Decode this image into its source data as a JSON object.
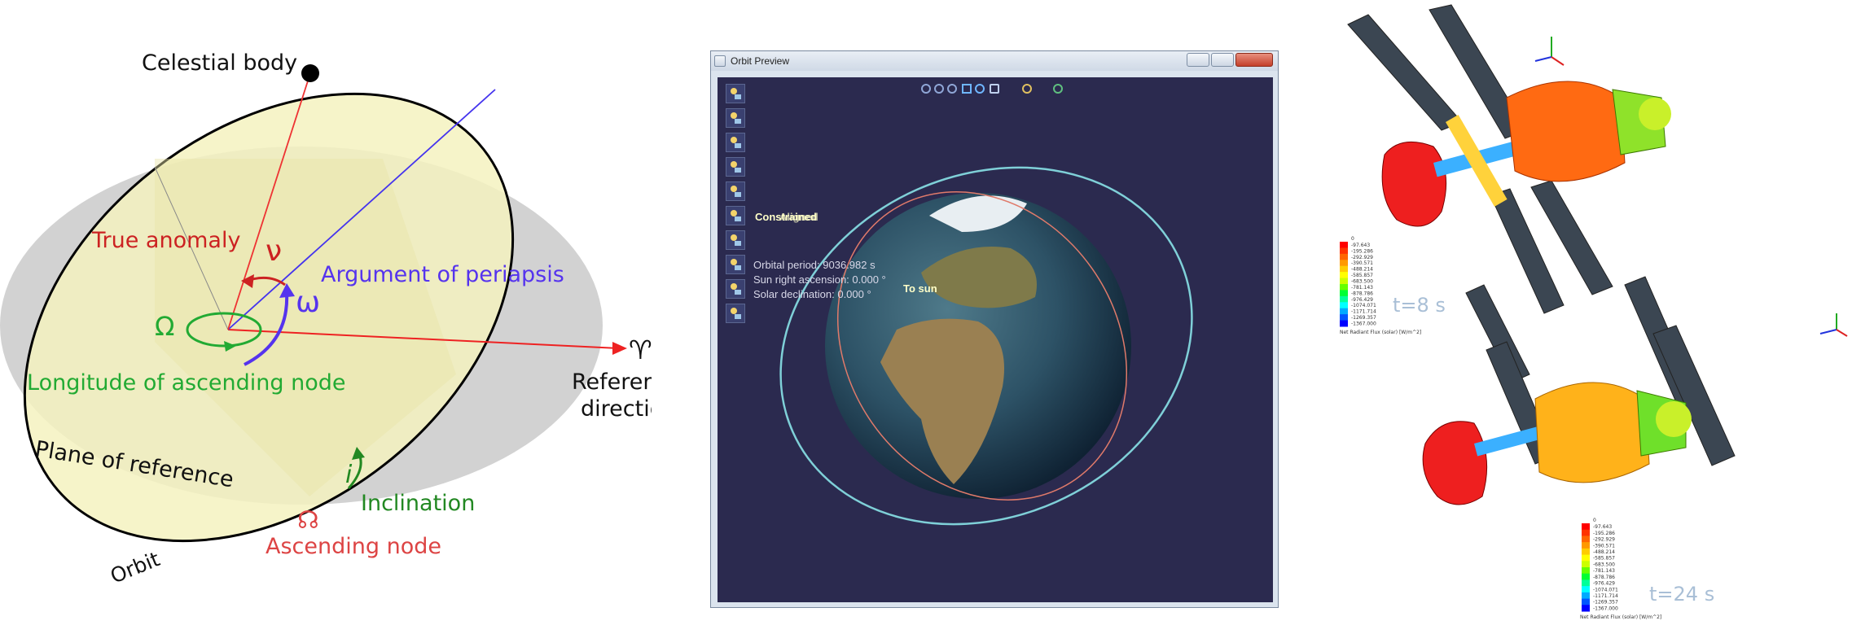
{
  "orbit_diagram": {
    "celestial_body": "Celestial body",
    "true_anomaly": "True anomaly",
    "nu_symbol": "ν",
    "argument_of_periapsis": "Argument of periapsis",
    "omega_small": "ω",
    "omega_capital": "Ω",
    "longitude_of_ascending_node": "Longitude of ascending node",
    "reference_symbol": "♈",
    "reference_direction_line1": "Reference",
    "reference_direction_line2": "direction",
    "plane_of_reference": "Plane of reference",
    "inclination_symbol": "i",
    "inclination": "Inclination",
    "ascending_node_symbol": "☊",
    "ascending_node": "Ascending node",
    "orbit": "Orbit",
    "colors": {
      "true_anomaly": "#cc2222",
      "argument_of_periapsis": "#5533ee",
      "longitude": "#22aa33",
      "ascending_node": "#dd4444",
      "inclination": "#228822",
      "orbit_fill": "#f5f2bf",
      "plane_fill": "#d2d2d2"
    }
  },
  "orbit_preview": {
    "window_title": "Orbit Preview",
    "orbital_period": "Orbital period: 9036.982 s",
    "sun_right_ascension": "Sun right ascension: 0.000 °",
    "solar_declination": "Solar declination: 0.000 °",
    "label_constrained": "Constrained",
    "label_aligned": "Aligned",
    "label_to_sun": "To sun",
    "icons": [
      "zoom-in-icon",
      "zoom-out-icon",
      "zoom-fit-icon",
      "pan-icon",
      "rotate-icon",
      "camera-icon",
      "satellite-icon",
      "globe-icon"
    ],
    "tool_count": 10
  },
  "thermal_sim": {
    "time_top": "t=8 s",
    "time_bottom": "t=24 s",
    "legend_title": "Net Radiant Flux (solar) [W/m^2]",
    "legend_header": "0",
    "legend_values": [
      "-97.643",
      "-195.286",
      "-292.929",
      "-390.571",
      "-488.214",
      "-585.857",
      "-683.500",
      "-781.143",
      "-878.786",
      "-976.429",
      "-1074.071",
      "-1171.714",
      "-1269.357",
      "-1367.000"
    ],
    "colorscale": [
      "#ff0000",
      "#ff3300",
      "#ff6600",
      "#ff9900",
      "#ffcc00",
      "#ffff00",
      "#ccff00",
      "#66ff00",
      "#00ff33",
      "#00ff99",
      "#00ffff",
      "#00aaff",
      "#0055ff",
      "#0000ff"
    ]
  }
}
